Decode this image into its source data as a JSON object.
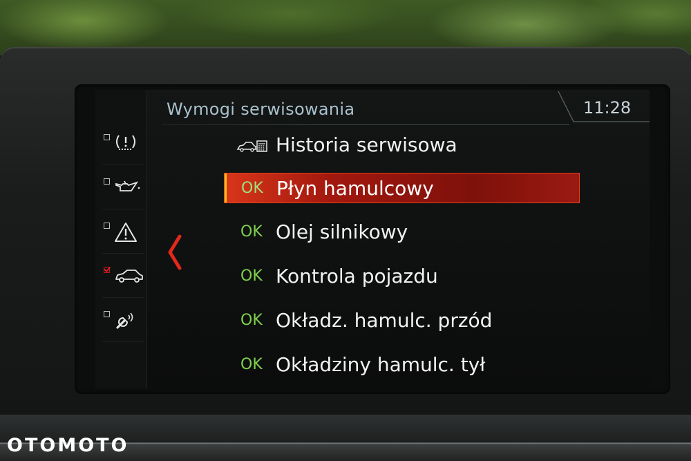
{
  "header": {
    "title": "Wymogi serwisowania",
    "time": "11:28"
  },
  "sidebar": {
    "items": [
      {
        "icon": "tire-pressure-icon",
        "checked": false
      },
      {
        "icon": "oil-can-icon",
        "checked": false
      },
      {
        "icon": "warning-triangle-icon",
        "checked": false
      },
      {
        "icon": "car-icon",
        "checked": true
      },
      {
        "icon": "wrench-remote-icon",
        "checked": false
      }
    ]
  },
  "menu": {
    "history": {
      "label": "Historia serwisowa",
      "icon": "service-history-icon"
    },
    "items": [
      {
        "status": "OK",
        "label": "Płyn hamulcowy",
        "selected": true
      },
      {
        "status": "OK",
        "label": "Olej silnikowy",
        "selected": false
      },
      {
        "status": "OK",
        "label": "Kontrola pojazdu",
        "selected": false
      },
      {
        "status": "OK",
        "label": "Okładz. hamulc. przód",
        "selected": false
      },
      {
        "status": "OK",
        "label": "Okładziny hamulc. tył",
        "selected": false
      }
    ]
  },
  "watermark": "OTOMOTO",
  "colors": {
    "ok": "#7ed14d",
    "selection": "#a2180e",
    "accent": "#d62020",
    "header_text": "#a9c1cc"
  }
}
